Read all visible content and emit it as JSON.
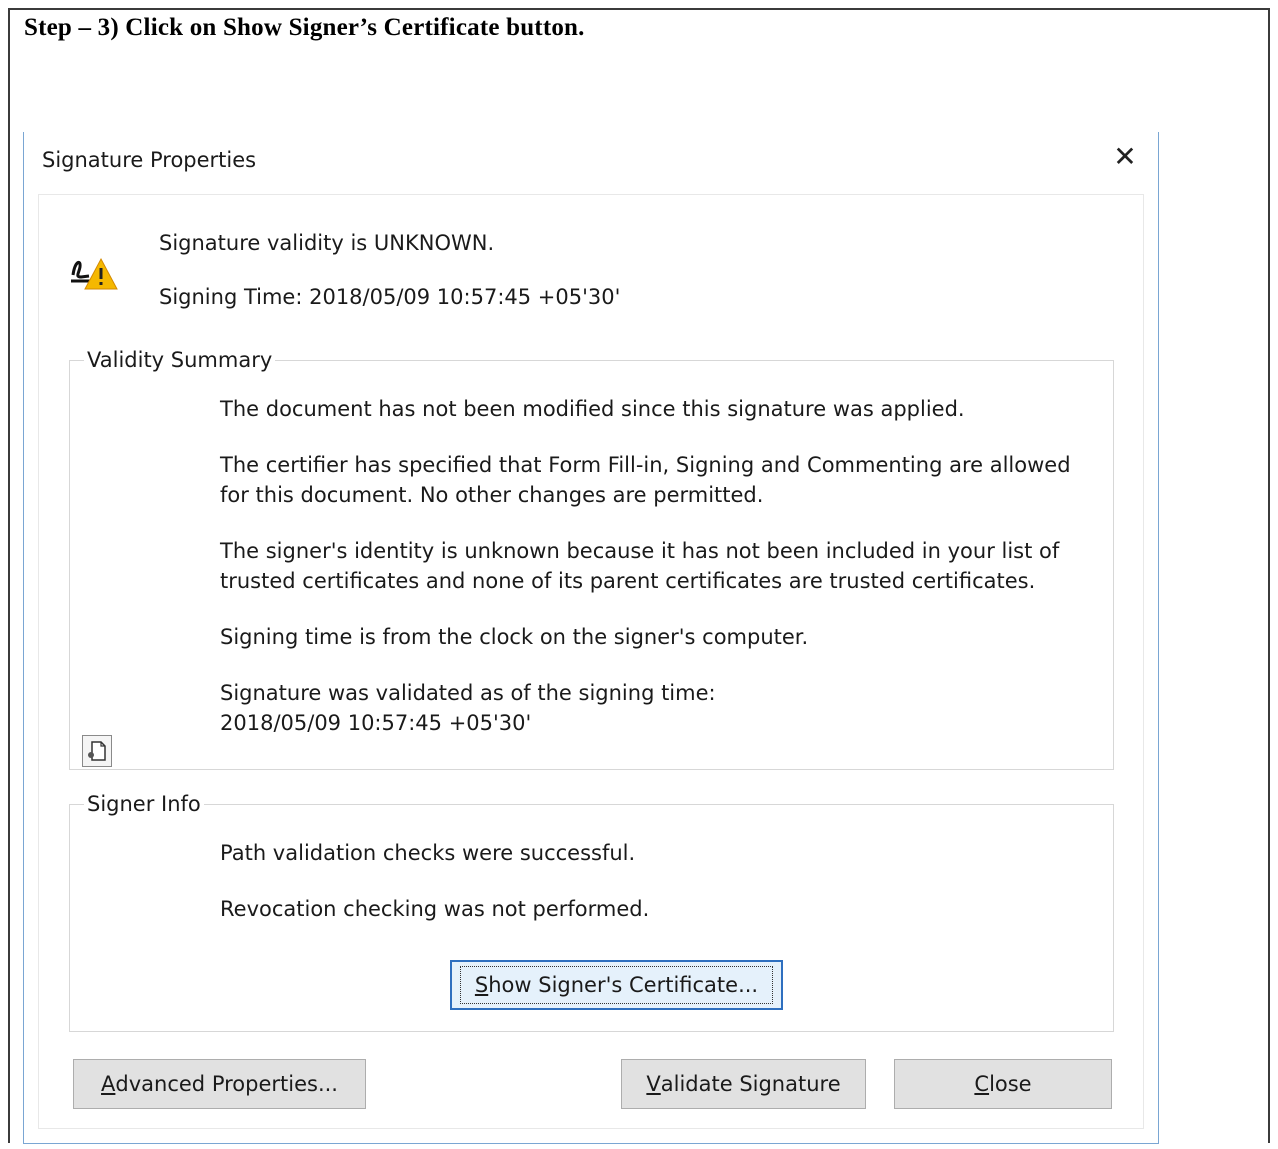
{
  "instruction": "Step – 3) Click on Show Signer’s Certificate button.",
  "dialog": {
    "title": "Signature Properties",
    "close_symbol": "✕",
    "validity_status": "Signature validity is UNKNOWN.",
    "signing_time": "Signing Time:  2018/05/09 10:57:45 +05'30'"
  },
  "validity_summary": {
    "legend": "Validity Summary",
    "lines": [
      "The document has not been modified since this signature was applied.",
      "The certifier has specified that Form Fill-in, Signing and Commenting are allowed for this document. No other changes are permitted.",
      "The signer's identity is unknown because it has not been included in your list of trusted certificates and none of its parent certificates are trusted certificates.",
      "Signing time is from the clock on the signer's computer.",
      "Signature was validated as of the signing time:",
      "2018/05/09 10:57:45 +05'30'"
    ]
  },
  "signer_info": {
    "legend": "Signer Info",
    "lines": [
      "Path validation checks were successful.",
      "Revocation checking was not performed."
    ],
    "show_cert_button": {
      "accel": "S",
      "rest": "how Signer's Certificate..."
    }
  },
  "buttons": {
    "advanced": {
      "accel": "A",
      "rest": "dvanced Properties..."
    },
    "validate": {
      "accel": "V",
      "rest": "alidate Signature"
    },
    "close": {
      "accel": "C",
      "rest": "lose"
    }
  },
  "icons": [
    "signature-warning-icon",
    "document-icon"
  ],
  "colors": {
    "dialog_border": "#7aa6d3",
    "focus_border": "#2e6fbf",
    "button_bg": "#e1e1e1",
    "warning": "#f5b800"
  }
}
